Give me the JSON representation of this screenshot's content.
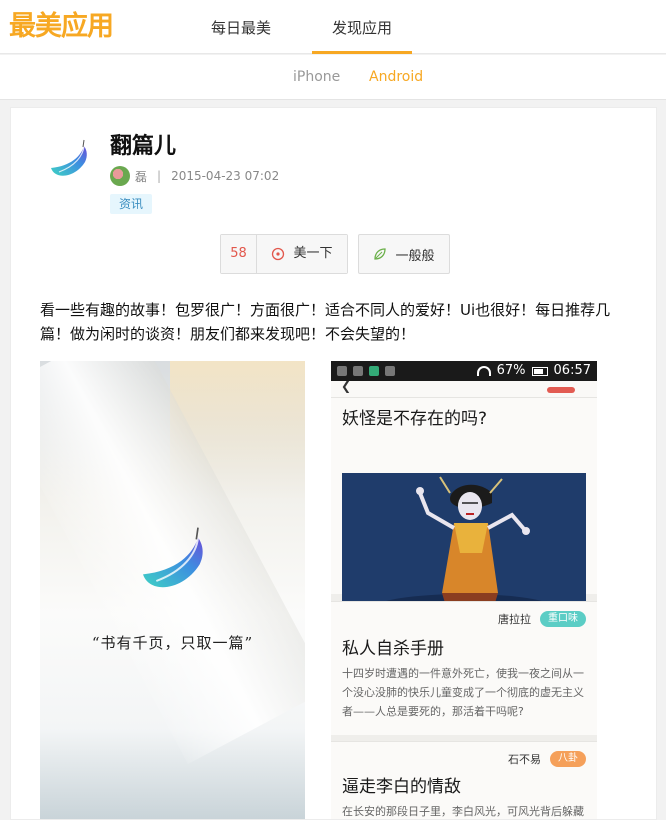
{
  "header": {
    "logo": "最美应用",
    "tabs": [
      {
        "label": "每日最美",
        "active": false
      },
      {
        "label": "发现应用",
        "active": true
      }
    ],
    "accent_color": "#f7a823"
  },
  "subnav": {
    "items": [
      {
        "label": "iPhone",
        "active": false
      },
      {
        "label": "Android",
        "active": true
      }
    ]
  },
  "app": {
    "icon": "feather-icon",
    "name": "翻篇儿",
    "author": "磊",
    "separator": "|",
    "date": "2015-04-23 07:02",
    "tag": "资讯",
    "like_count": "58",
    "like_label": "美一下",
    "meh_label": "一般般",
    "description": "看一些有趣的故事！包罗很广！方面很广！适合不同人的爱好！Ui也很好！每日推荐几篇！做为闲时的谈资！朋友们都来发现吧！不会失望的！"
  },
  "screenshot1": {
    "quote": "“书有千页，只取一篇”"
  },
  "screenshot2": {
    "status": {
      "battery": "67%",
      "time": "06:57"
    },
    "cards": [
      {
        "title": "妖怪是不存在的吗?"
      },
      {
        "author": "唐拉拉",
        "badge": "重口味",
        "badge_color": "#5bcdc5",
        "title": "私人自杀手册",
        "excerpt": "十四岁时遭遇的一件意外死亡，使我一夜之间从一个没心没肺的快乐儿童变成了一个彻底的虚无主义者——人总是要死的，那活着干吗呢?"
      },
      {
        "author": "石不易",
        "badge": "八卦",
        "badge_color": "#f5a05a",
        "title": "逼走李白的情敌",
        "excerpt": "在长安的那段日子里，李白风光，可风光背后躲藏着"
      }
    ]
  }
}
